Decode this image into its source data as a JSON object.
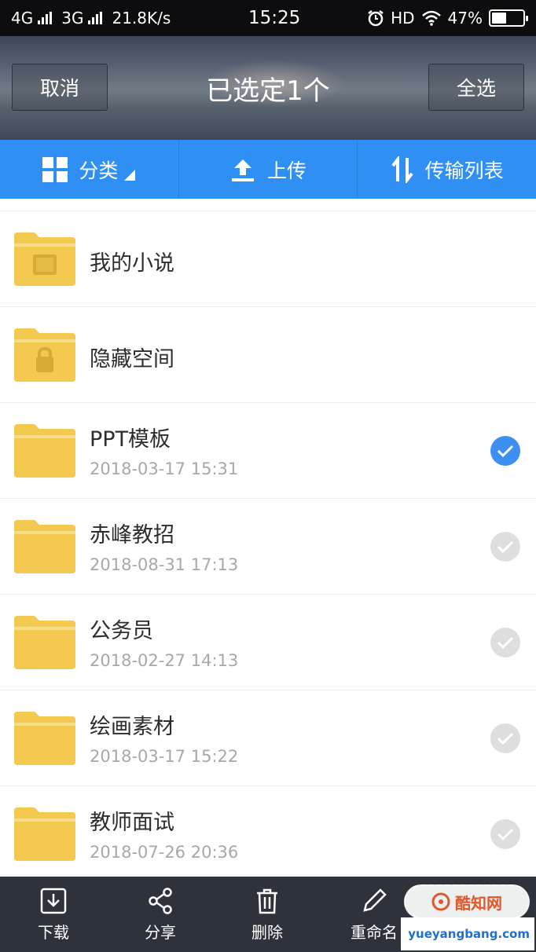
{
  "status_bar": {
    "network1": "4G",
    "network2": "3G",
    "speed": "21.8K/s",
    "time": "15:25",
    "hd": "HD",
    "battery": "47%",
    "battery_level": 0.47
  },
  "header": {
    "cancel_label": "取消",
    "title": "已选定1个",
    "select_all_label": "全选"
  },
  "toolbar": {
    "category_label": "分类",
    "upload_label": "上传",
    "transfer_label": "传输列表"
  },
  "files": [
    {
      "name": "我的小说",
      "date": "",
      "selected": null,
      "icon": "book-folder-icon"
    },
    {
      "name": "隐藏空间",
      "date": "",
      "selected": null,
      "icon": "lock-folder-icon"
    },
    {
      "name": "PPT模板",
      "date": "2018-03-17  15:31",
      "selected": true,
      "icon": "folder-icon"
    },
    {
      "name": "赤峰教招",
      "date": "2018-08-31  17:13",
      "selected": false,
      "icon": "folder-icon"
    },
    {
      "name": "公务员",
      "date": "2018-02-27  14:13",
      "selected": false,
      "icon": "folder-icon"
    },
    {
      "name": "绘画素材",
      "date": "2018-03-17  15:22",
      "selected": false,
      "icon": "folder-icon"
    },
    {
      "name": "教师面试",
      "date": "2018-07-26  20:36",
      "selected": false,
      "icon": "folder-icon"
    }
  ],
  "bottom_bar": {
    "download_label": "下载",
    "share_label": "分享",
    "delete_label": "删除",
    "rename_label": "重命名"
  },
  "watermark": {
    "brand": "酷知网",
    "site": "yueyangbang.com"
  },
  "colors": {
    "toolbar": "#2f8ff2",
    "folder": "#f3c94f",
    "check_on": "#3d8ff0",
    "bottom_bar": "#2e323b"
  }
}
